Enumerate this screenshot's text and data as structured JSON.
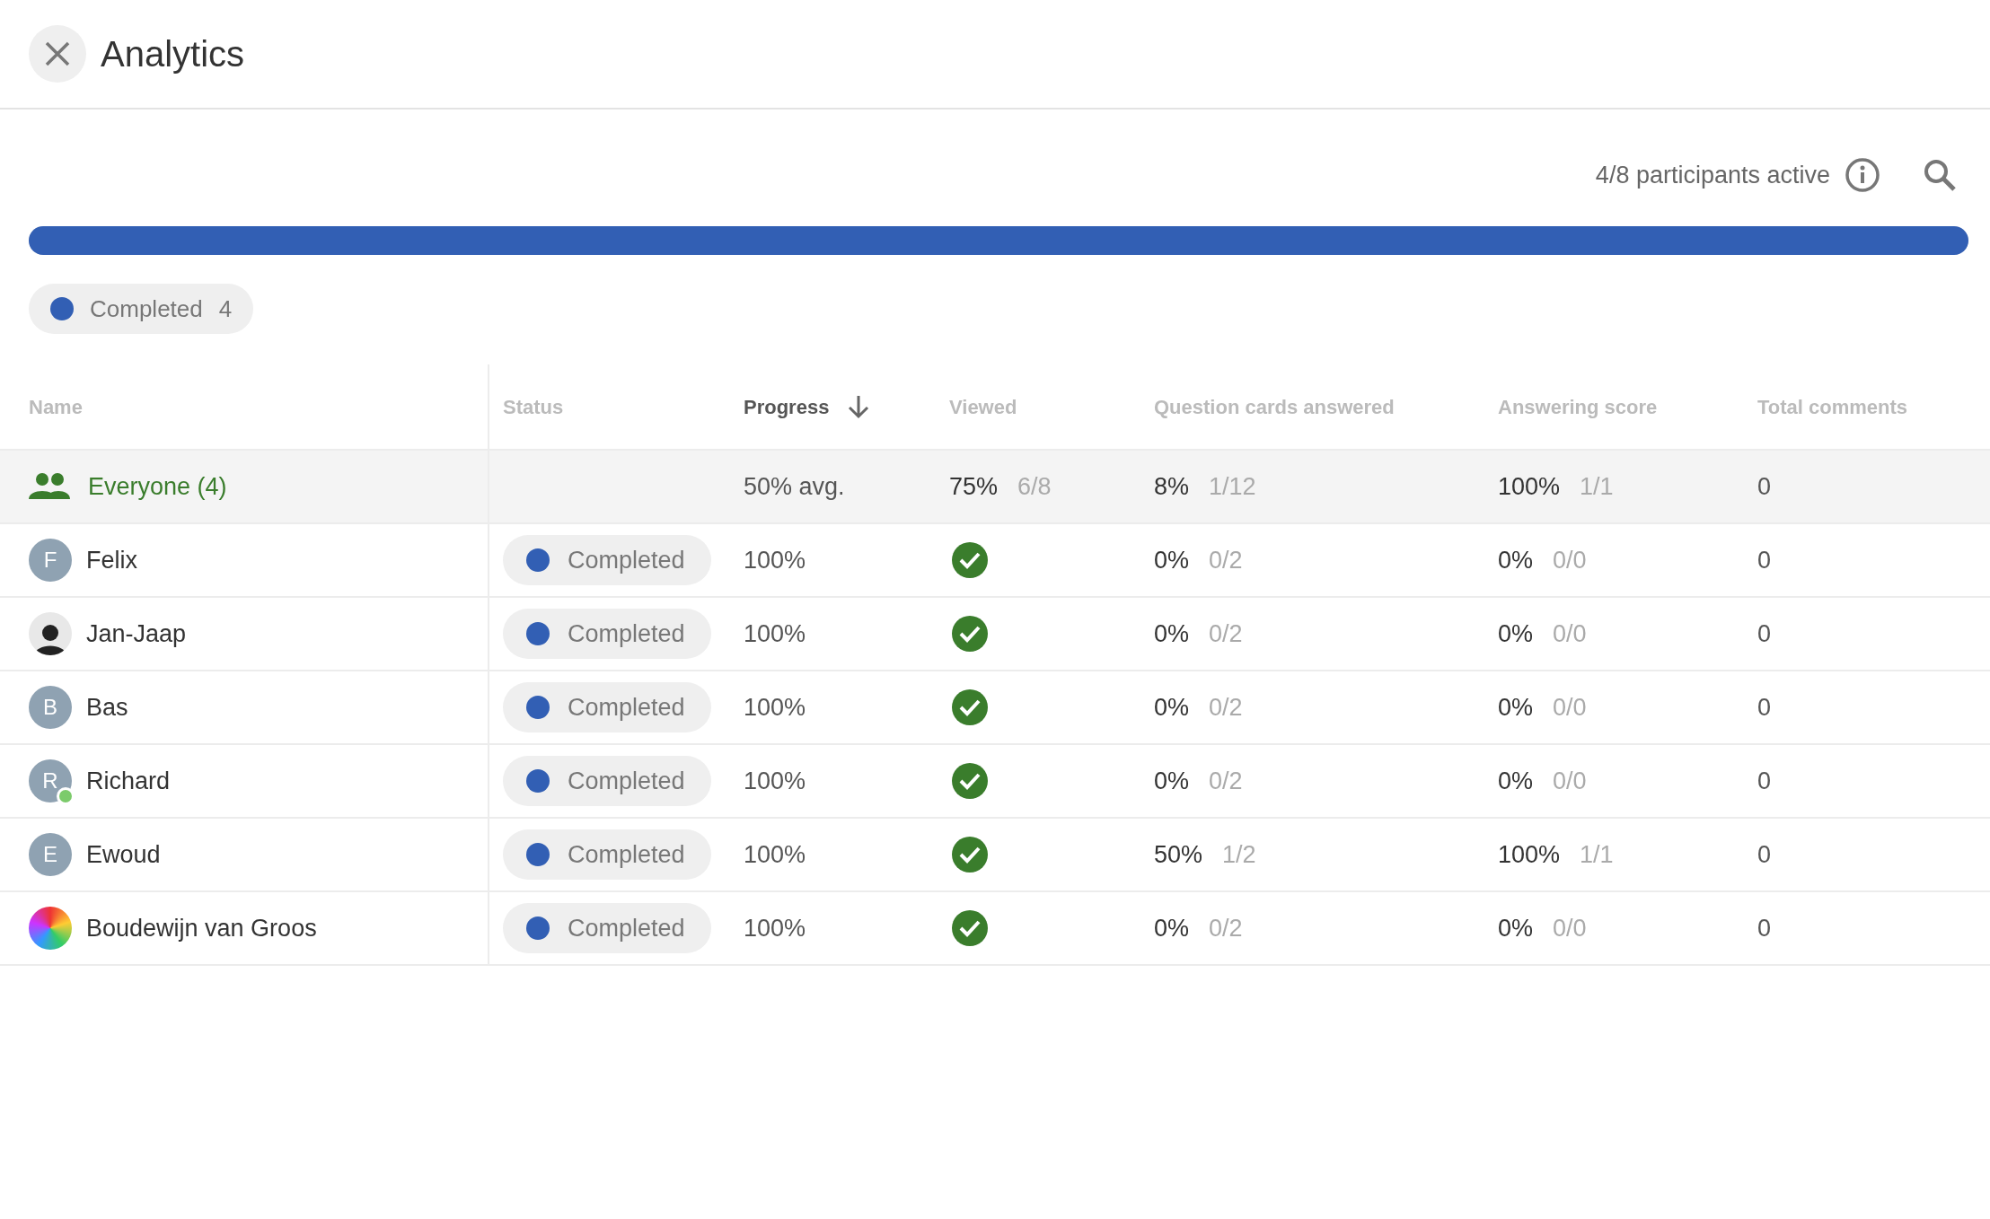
{
  "window": {
    "title": "Analytics"
  },
  "summary": {
    "active_text": "4/8 participants active"
  },
  "progress_bar": {
    "level": 1,
    "color": "#325fb4"
  },
  "legend": [
    {
      "label": "Completed",
      "count": "4",
      "color": "#325fb4"
    }
  ],
  "table": {
    "columns": [
      {
        "label": "Name",
        "sorted": false
      },
      {
        "label": "Status",
        "sorted": false
      },
      {
        "label": "Progress",
        "sorted": true
      },
      {
        "label": "Viewed",
        "sorted": false
      },
      {
        "label": "Question cards answered",
        "sorted": false
      },
      {
        "label": "Answering score",
        "sorted": false
      },
      {
        "label": "Total comments",
        "sorted": false
      }
    ],
    "group_row": {
      "name": "Everyone (4)",
      "progress": "50% avg.",
      "viewed": {
        "pct": "75%",
        "count": "6/8"
      },
      "questions": {
        "pct": "8%",
        "count": "1/12"
      },
      "score": {
        "pct": "100%",
        "count": "1/1"
      },
      "comments": "0"
    },
    "rows": [
      {
        "name": "Felix",
        "avatar": {
          "kind": "initial",
          "letter": "F",
          "online": false
        },
        "status": {
          "label": "Completed",
          "color": "#325fb4"
        },
        "progress": "100%",
        "viewed": true,
        "questions": {
          "pct": "0%",
          "count": "0/2"
        },
        "score": {
          "pct": "0%",
          "count": "0/0"
        },
        "comments": "0"
      },
      {
        "name": "Jan-Jaap",
        "avatar": {
          "kind": "photo",
          "online": false
        },
        "status": {
          "label": "Completed",
          "color": "#325fb4"
        },
        "progress": "100%",
        "viewed": true,
        "questions": {
          "pct": "0%",
          "count": "0/2"
        },
        "score": {
          "pct": "0%",
          "count": "0/0"
        },
        "comments": "0"
      },
      {
        "name": "Bas",
        "avatar": {
          "kind": "initial",
          "letter": "B",
          "online": false
        },
        "status": {
          "label": "Completed",
          "color": "#325fb4"
        },
        "progress": "100%",
        "viewed": true,
        "questions": {
          "pct": "0%",
          "count": "0/2"
        },
        "score": {
          "pct": "0%",
          "count": "0/0"
        },
        "comments": "0"
      },
      {
        "name": "Richard",
        "avatar": {
          "kind": "initial",
          "letter": "R",
          "online": true
        },
        "status": {
          "label": "Completed",
          "color": "#325fb4"
        },
        "progress": "100%",
        "viewed": true,
        "questions": {
          "pct": "0%",
          "count": "0/2"
        },
        "score": {
          "pct": "0%",
          "count": "0/0"
        },
        "comments": "0"
      },
      {
        "name": "Ewoud",
        "avatar": {
          "kind": "initial",
          "letter": "E",
          "online": false
        },
        "status": {
          "label": "Completed",
          "color": "#325fb4"
        },
        "progress": "100%",
        "viewed": true,
        "questions": {
          "pct": "50%",
          "count": "1/2"
        },
        "score": {
          "pct": "100%",
          "count": "1/1"
        },
        "comments": "0"
      },
      {
        "name": "Boudewijn van Groos",
        "avatar": {
          "kind": "artwork",
          "online": false
        },
        "status": {
          "label": "Completed",
          "color": "#325fb4"
        },
        "progress": "100%",
        "viewed": true,
        "questions": {
          "pct": "0%",
          "count": "0/2"
        },
        "score": {
          "pct": "0%",
          "count": "0/0"
        },
        "comments": "0"
      }
    ]
  }
}
